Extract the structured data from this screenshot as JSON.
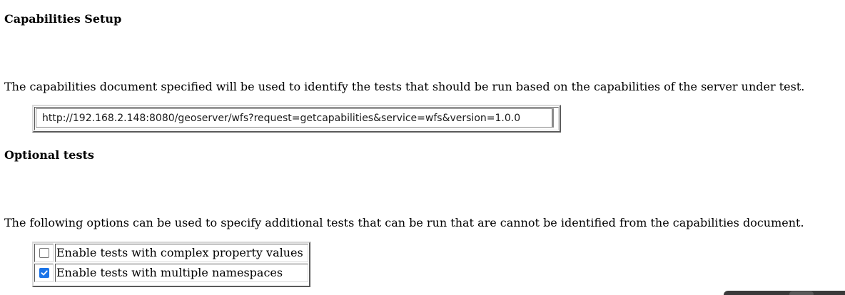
{
  "capabilities": {
    "title": "Capabilities Setup",
    "description": "The capabilities document specified will be used to identify the tests that should be run based on the capabilities of the server under test.",
    "url_value": "http://192.168.2.148:8080/geoserver/wfs?request=getcapabilities&service=wfs&version=1.0.0"
  },
  "optional": {
    "title": "Optional tests",
    "description": "The following options can be used to specify additional tests that can be run that are cannot be identified from the capabilities document.",
    "options": [
      {
        "label": "Enable tests with complex property values",
        "checked": false
      },
      {
        "label": "Enable tests with multiple namespaces",
        "checked": true
      }
    ]
  },
  "colors": {
    "checkbox_checked": "#1a73e8"
  }
}
